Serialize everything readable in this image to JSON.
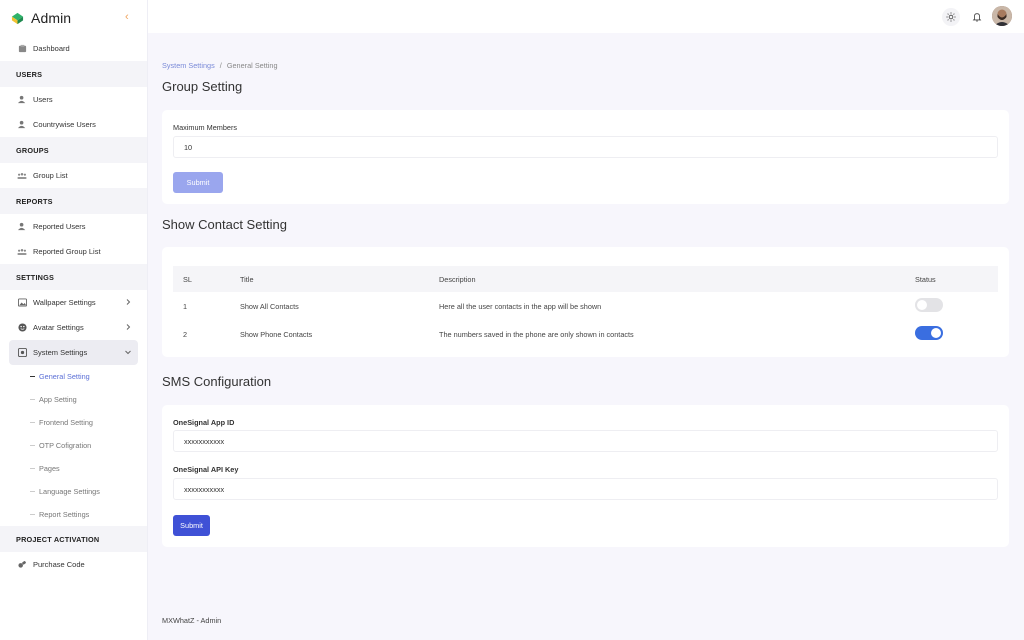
{
  "brand": {
    "name": "Admin"
  },
  "sidebar": {
    "dashboard": "Dashboard",
    "sections": {
      "users": "USERS",
      "groups": "GROUPS",
      "reports": "REPORTS",
      "settings": "SETTINGS",
      "project_activation": "PROJECT ACTIVATION"
    },
    "items": {
      "users": "Users",
      "countrywise_users": "Countrywise Users",
      "group_list": "Group List",
      "reported_users": "Reported Users",
      "reported_group_list": "Reported Group List",
      "wallpaper_settings": "Wallpaper Settings",
      "avatar_settings": "Avatar Settings",
      "system_settings": "System Settings",
      "purchase_code": "Purchase Code"
    },
    "system_sub": {
      "general_setting": "General Setting",
      "app_setting": "App Setting",
      "frontend_setting": "Frontend Setting",
      "otp_configuration": "OTP Cofigration",
      "pages": "Pages",
      "language_settings": "Language Settings",
      "report_settings": "Report Settings"
    }
  },
  "breadcrumb": {
    "parent": "System Settings",
    "separator": "/",
    "current": "General Setting"
  },
  "group_setting": {
    "title": "Group Setting",
    "max_members_label": "Maximum Members",
    "max_members_value": "10",
    "submit_label": "Submit"
  },
  "contact_setting": {
    "title": "Show Contact Setting",
    "columns": {
      "sl": "SL",
      "title": "Title",
      "description": "Description",
      "status": "Status"
    },
    "rows": [
      {
        "sl": "1",
        "title": "Show All Contacts",
        "description": "Here all the user contacts in the app will be shown",
        "status": "off"
      },
      {
        "sl": "2",
        "title": "Show Phone Contacts",
        "description": "The numbers saved in the phone are only shown in contacts",
        "status": "on"
      }
    ]
  },
  "sms_config": {
    "title": "SMS Configuration",
    "app_id_label": "OneSignal App ID",
    "app_id_value": "xxxxxxxxxxx",
    "api_key_label": "OneSignal API Key",
    "api_key_value": "xxxxxxxxxxx",
    "submit_label": "Submit"
  },
  "footer": {
    "text": "MXWhatZ - Admin"
  },
  "colors": {
    "accent": "#3f51d6",
    "accent_light": "#9aa6ee",
    "toggle_on": "#3a6ee0",
    "background": "#f7f6fc"
  }
}
